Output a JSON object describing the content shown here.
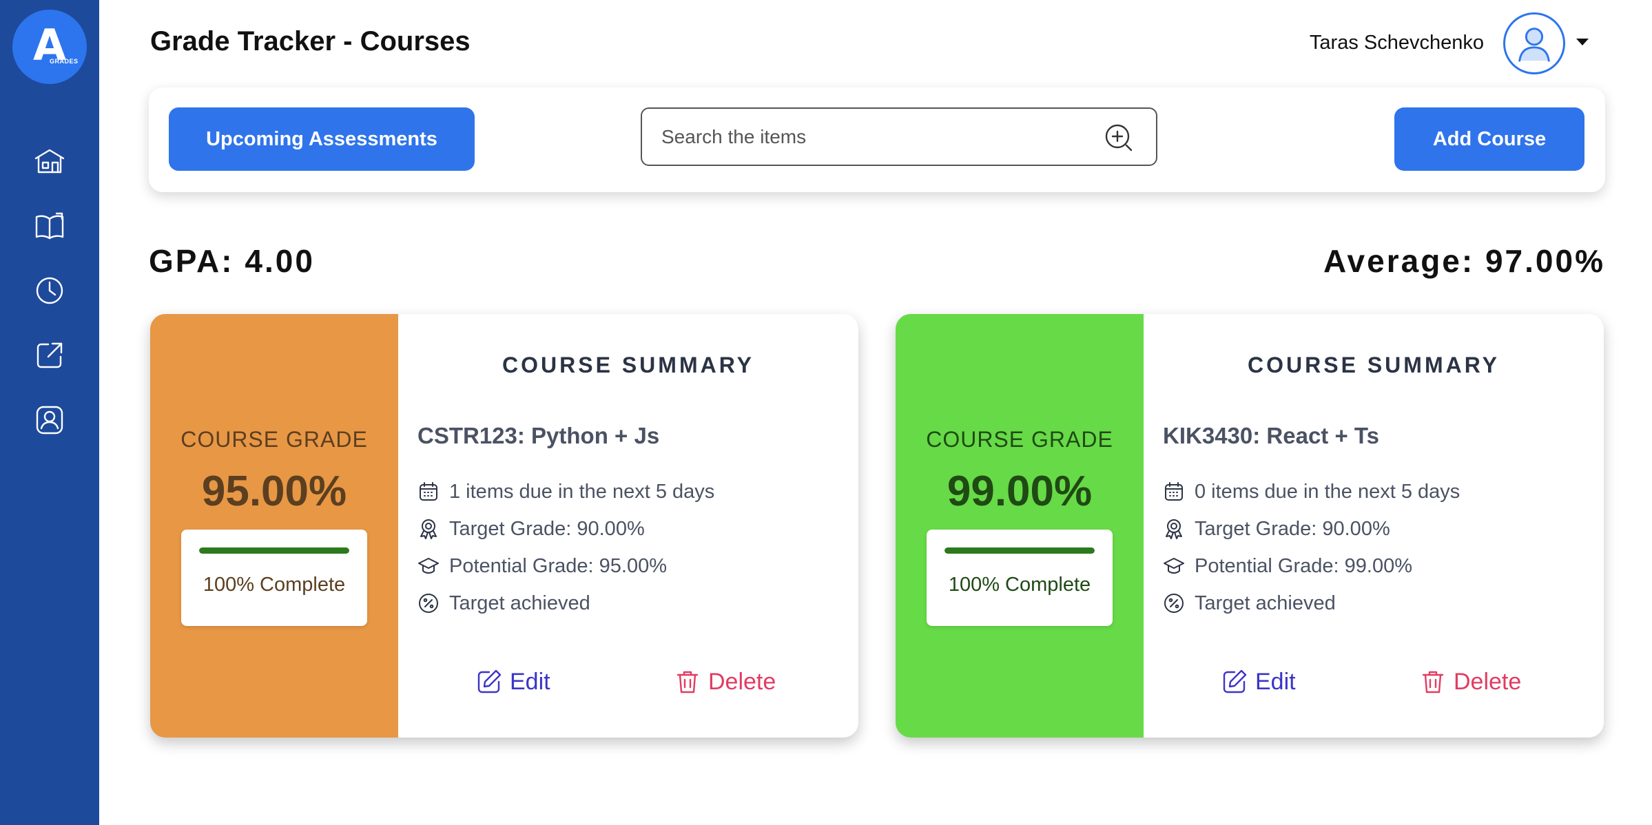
{
  "app": {
    "logo_letter": "A",
    "logo_small": "GRADES",
    "title": "Grade Tracker - Courses"
  },
  "sidebar": {
    "items": [
      {
        "icon": "home-icon"
      },
      {
        "icon": "book-icon"
      },
      {
        "icon": "clock-icon"
      },
      {
        "icon": "external-link-icon"
      },
      {
        "icon": "user-badge-icon"
      }
    ]
  },
  "header": {
    "user_name": "Taras Schevchenko",
    "avatar_icon": "user-icon"
  },
  "toolbar": {
    "upcoming_label": "Upcoming Assessments",
    "search_placeholder": "Search the items",
    "add_course_label": "Add Course"
  },
  "stats": {
    "gpa": "GPA: 4.00",
    "average": "Average: 97.00%"
  },
  "colors": {
    "accent": "#2f74eb",
    "sidebar": "#1e4a9b",
    "edit": "#3b34c8",
    "delete": "#e23b62"
  },
  "courses": [
    {
      "panel_color": "#e89745",
      "panel_text_color": "#5b3f20",
      "grade_label": "COURSE GRADE",
      "grade_value": "95.00%",
      "progress": 1.0,
      "progress_text": "100% Complete",
      "summary_title": "COURSE SUMMARY",
      "name": "CSTR123: Python + Js",
      "due": "1 items due in the next 5 days",
      "target": "Target Grade: 90.00%",
      "potential": "Potential Grade: 95.00%",
      "status": "Target achieved",
      "edit_label": "Edit",
      "delete_label": "Delete"
    },
    {
      "panel_color": "#67da47",
      "panel_text_color": "#1f4a14",
      "grade_label": "COURSE GRADE",
      "grade_value": "99.00%",
      "progress": 1.0,
      "progress_text": "100% Complete",
      "summary_title": "COURSE SUMMARY",
      "name": "KIK3430: React + Ts",
      "due": "0 items due in the next 5 days",
      "target": "Target Grade: 90.00%",
      "potential": "Potential Grade: 99.00%",
      "status": "Target achieved",
      "edit_label": "Edit",
      "delete_label": "Delete"
    }
  ]
}
